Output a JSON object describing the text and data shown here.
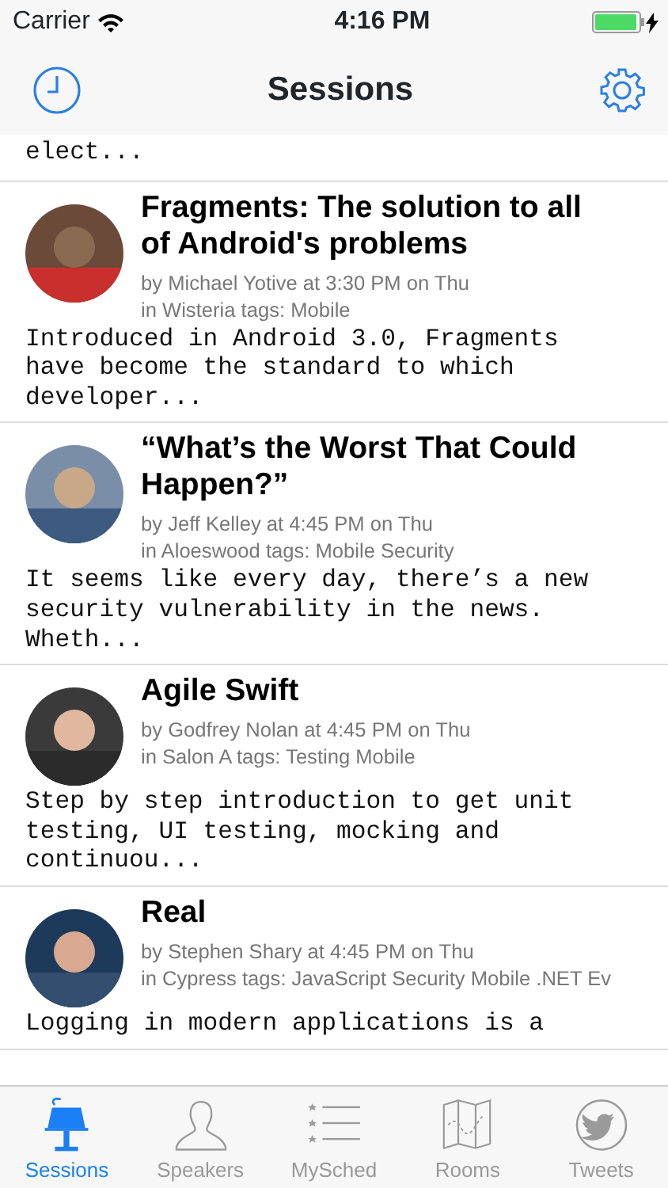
{
  "status_bar": {
    "carrier": "Carrier",
    "time": "4:16 PM",
    "charging": true
  },
  "nav_bar": {
    "title": "Sessions"
  },
  "partial_description": "elect...",
  "sessions": [
    {
      "title": "Fragments: The solution to all of Android's problems",
      "speaker_line": "by Michael Yotive at 3:30 PM on Thu",
      "location_line": "in Wisteria tags: Mobile",
      "description": "Introduced in Android 3.0, Fragments have become the standard to which developer..."
    },
    {
      "title": "“What’s the Worst That Could Happen?”",
      "speaker_line": "by Jeff Kelley at 4:45 PM on Thu",
      "location_line": "in Aloeswood tags: Mobile Security",
      "description": "It seems like every day, there’s a new security vulnerability in the news. Wheth..."
    },
    {
      "title": "Agile Swift",
      "speaker_line": "by Godfrey Nolan at 4:45 PM on Thu",
      "location_line": "in Salon A tags: Testing Mobile",
      "description": "Step by step introduction to get unit testing, UI testing, mocking and continuou..."
    },
    {
      "title": "Real",
      "speaker_line": "by Stephen Shary at 4:45 PM on Thu",
      "location_line": "in Cypress tags: JavaScript Security Mobile .NET Ev",
      "description": "Logging in modern applications is a"
    }
  ],
  "tabs": [
    {
      "kind": "podium",
      "label": "Sessions",
      "selected": true
    },
    {
      "kind": "person",
      "label": "Speakers",
      "selected": false
    },
    {
      "kind": "list",
      "label": "MySched",
      "selected": false
    },
    {
      "kind": "map",
      "label": "Rooms",
      "selected": false
    },
    {
      "kind": "bird",
      "label": "Tweets",
      "selected": false
    }
  ]
}
